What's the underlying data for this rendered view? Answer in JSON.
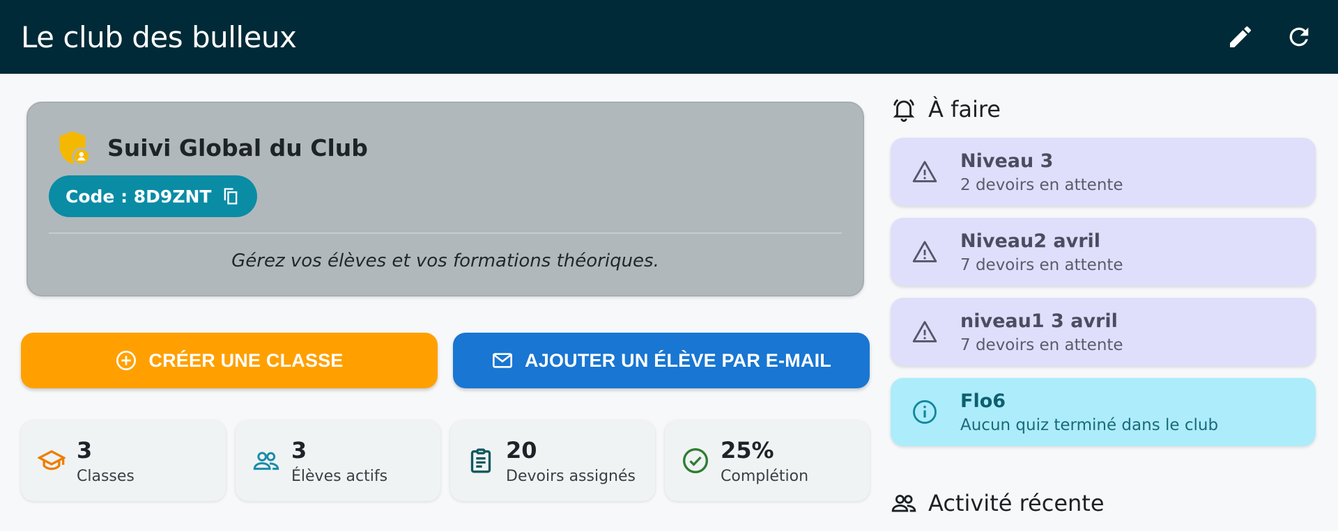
{
  "appbar": {
    "title": "Le club des bulleux",
    "background": "#002a37"
  },
  "summary": {
    "title": "Suivi Global du Club",
    "code_label": "Code : 8D9ZNT",
    "subtitle": "Gérez vos élèves et vos formations théoriques."
  },
  "actions": {
    "create_class": "CRÉER UNE CLASSE",
    "add_student": "AJOUTER UN ÉLÈVE PAR E-MAIL"
  },
  "stats": [
    {
      "value": "3",
      "label": "Classes",
      "icon": "school-icon",
      "color": "#ef7d00"
    },
    {
      "value": "3",
      "label": "Élèves actifs",
      "icon": "people-icon",
      "color": "#1a8ca8"
    },
    {
      "value": "20",
      "label": "Devoirs assignés",
      "icon": "clipboard-icon",
      "color": "#12585f"
    },
    {
      "value": "25%",
      "label": "Complétion",
      "icon": "check-circle-icon",
      "color": "#2e7d32"
    }
  ],
  "todo": {
    "title": "À faire",
    "items": [
      {
        "title": "Niveau 3",
        "subtitle": "2 devoirs en attente",
        "type": "warning"
      },
      {
        "title": "Niveau2 avril",
        "subtitle": "7 devoirs en attente",
        "type": "warning"
      },
      {
        "title": "niveau1 3 avril",
        "subtitle": "7 devoirs en attente",
        "type": "warning"
      },
      {
        "title": "Flo6",
        "subtitle": "Aucun quiz terminé dans le club",
        "type": "info"
      }
    ]
  },
  "recent": {
    "title": "Activité récente"
  },
  "colors": {
    "create_button": "#ffa000",
    "add_button": "#1976d2",
    "code_chip": "#0a8ca5",
    "warning_card": "#dfdffc",
    "info_card": "#adecfb"
  }
}
